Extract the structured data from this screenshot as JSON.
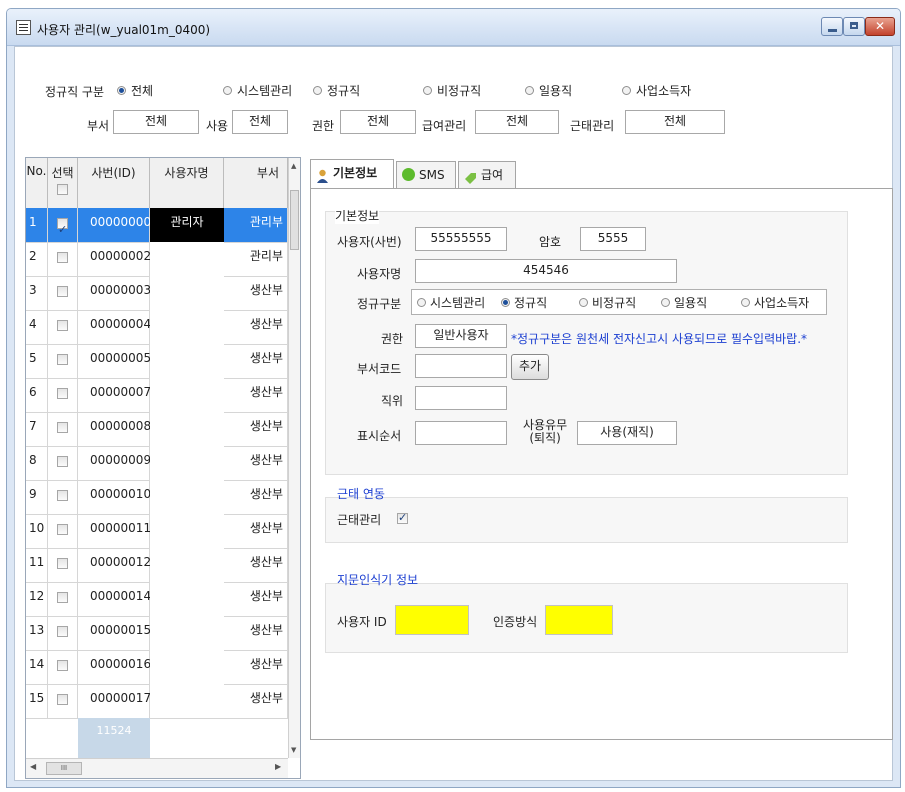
{
  "window": {
    "title": "사용자 관리(w_yual01m_0400)"
  },
  "filters": {
    "type_label": "정규직 구분",
    "type_options": [
      {
        "label": "전체",
        "selected": true
      },
      {
        "label": "시스템관리",
        "selected": false
      },
      {
        "label": "정규직",
        "selected": false
      },
      {
        "label": "비정규직",
        "selected": false
      },
      {
        "label": "일용직",
        "selected": false
      },
      {
        "label": "사업소득자",
        "selected": false
      }
    ],
    "dept_label": "부서",
    "dept_value": "전체",
    "use_label": "사용",
    "use_value": "전체",
    "auth_label": "권한",
    "auth_value": "전체",
    "pay_label": "급여관리",
    "pay_value": "전체",
    "att_label": "근태관리",
    "att_value": "전체"
  },
  "grid": {
    "columns": [
      "No.",
      "선택",
      "사번(ID)",
      "사용자명",
      "부서"
    ],
    "rows": [
      {
        "no": "1",
        "checked": true,
        "id": "00000000",
        "name": "관리자",
        "dept": "관리부"
      },
      {
        "no": "2",
        "checked": false,
        "id": "00000002",
        "name": "",
        "dept": "관리부"
      },
      {
        "no": "3",
        "checked": false,
        "id": "00000003",
        "name": "",
        "dept": "생산부"
      },
      {
        "no": "4",
        "checked": false,
        "id": "00000004",
        "name": "",
        "dept": "생산부"
      },
      {
        "no": "5",
        "checked": false,
        "id": "00000005",
        "name": "",
        "dept": "생산부"
      },
      {
        "no": "6",
        "checked": false,
        "id": "00000007",
        "name": "",
        "dept": "생산부"
      },
      {
        "no": "7",
        "checked": false,
        "id": "00000008",
        "name": "",
        "dept": "생산부"
      },
      {
        "no": "8",
        "checked": false,
        "id": "00000009",
        "name": "",
        "dept": "생산부"
      },
      {
        "no": "9",
        "checked": false,
        "id": "00000010",
        "name": "",
        "dept": "생산부"
      },
      {
        "no": "10",
        "checked": false,
        "id": "00000011",
        "name": "",
        "dept": "생산부"
      },
      {
        "no": "11",
        "checked": false,
        "id": "00000012",
        "name": "",
        "dept": "생산부"
      },
      {
        "no": "12",
        "checked": false,
        "id": "00000014",
        "name": "",
        "dept": "생산부"
      },
      {
        "no": "13",
        "checked": false,
        "id": "00000015",
        "name": "",
        "dept": "생산부"
      },
      {
        "no": "14",
        "checked": false,
        "id": "00000016",
        "name": "",
        "dept": "생산부"
      },
      {
        "no": "15",
        "checked": false,
        "id": "00000017",
        "name": "",
        "dept": "생산부"
      }
    ],
    "footer_count": "11524",
    "hscroll_grip": "III"
  },
  "tabs": [
    {
      "label": "기본정보",
      "icon": "user-icon",
      "active": true
    },
    {
      "label": "SMS",
      "icon": "sms-icon",
      "active": false
    },
    {
      "label": "급여",
      "icon": "tag-icon",
      "active": false
    }
  ],
  "basic": {
    "section_title": "기본정보",
    "user_no_label": "사용자(사번)",
    "user_no_value": "55555555",
    "password_label": "암호",
    "password_value": "5555",
    "name_label": "사용자명",
    "name_value": "454546",
    "type_label": "정규구분",
    "type_options": [
      {
        "label": "시스템관리",
        "selected": false
      },
      {
        "label": "정규직",
        "selected": true
      },
      {
        "label": "비정규직",
        "selected": false
      },
      {
        "label": "일용직",
        "selected": false
      },
      {
        "label": "사업소득자",
        "selected": false
      }
    ],
    "auth_label": "권한",
    "auth_value": "일반사용자",
    "notice": "*정규구분은 원천세 전자신고시 사용되므로 필수입력바랍.*",
    "dept_code_label": "부서코드",
    "dept_code_value": "",
    "add_button": "추가",
    "position_label": "직위",
    "position_value": "",
    "order_label": "표시순서",
    "order_value": "",
    "use_label_line1": "사용유무",
    "use_label_line2": "(퇴직)",
    "use_value": "사용(재직)"
  },
  "attendance": {
    "section_title": "근태 연동",
    "label": "근태관리",
    "checked": true
  },
  "fingerprint": {
    "section_title": "지문인식기 정보",
    "user_id_label": "사용자 ID",
    "auth_method_label": "인증방식",
    "field_color": "#ffff00"
  }
}
